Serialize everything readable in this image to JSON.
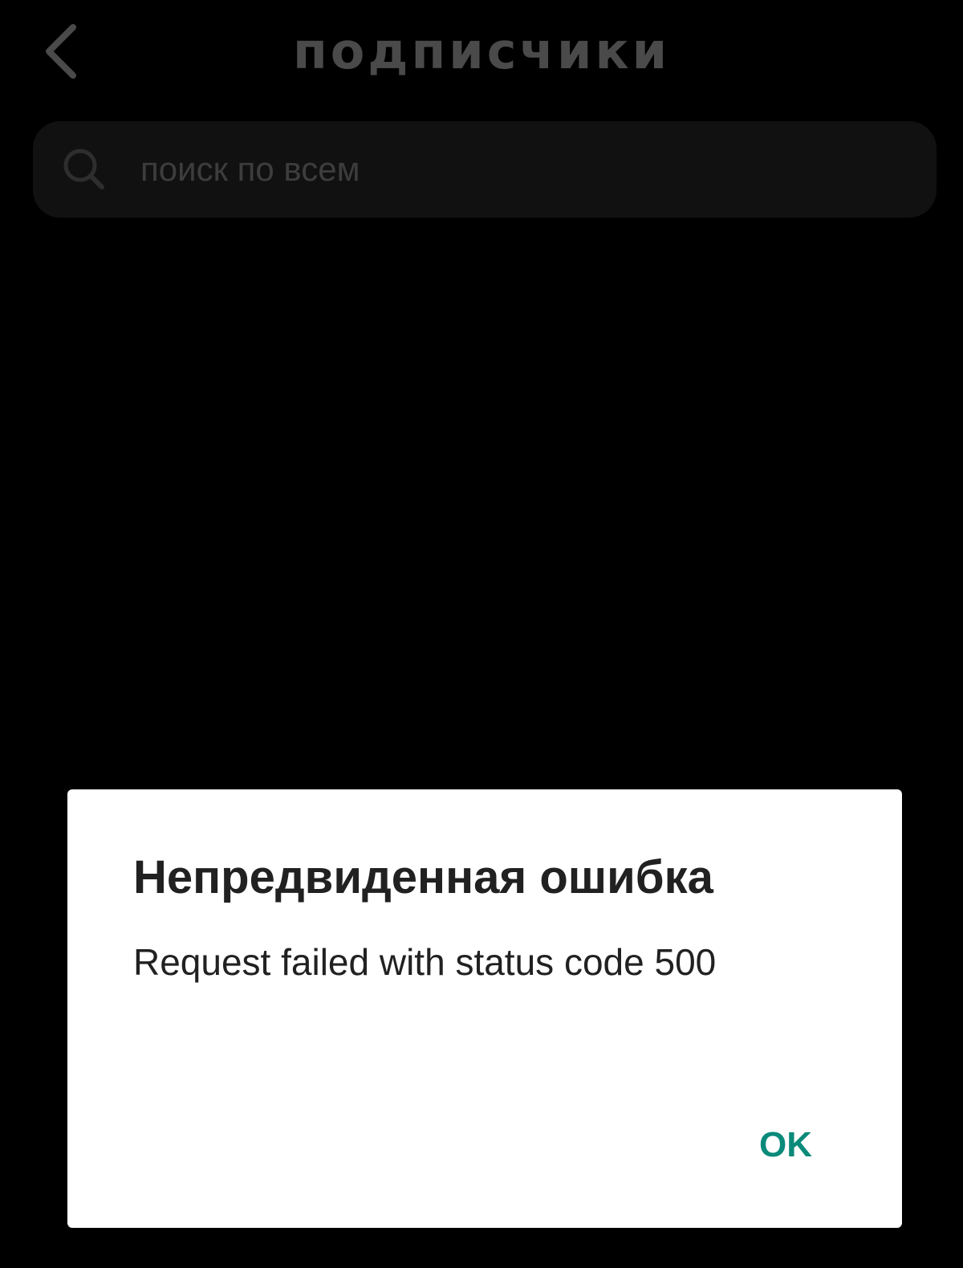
{
  "header": {
    "back_icon": "chevron-left-icon",
    "title": "подписчики"
  },
  "search": {
    "icon": "search-icon",
    "placeholder": "поиск по всем",
    "value": ""
  },
  "dialog": {
    "title": "Непредвиденная ошибка",
    "message": "Request failed with status code 500",
    "ok_label": "OK"
  },
  "colors": {
    "background": "#000000",
    "dimmed_text": "#4a4a4a",
    "search_bg": "#111111",
    "dialog_bg": "#ffffff",
    "dialog_text": "#212121",
    "accent": "#0a8a7a"
  }
}
